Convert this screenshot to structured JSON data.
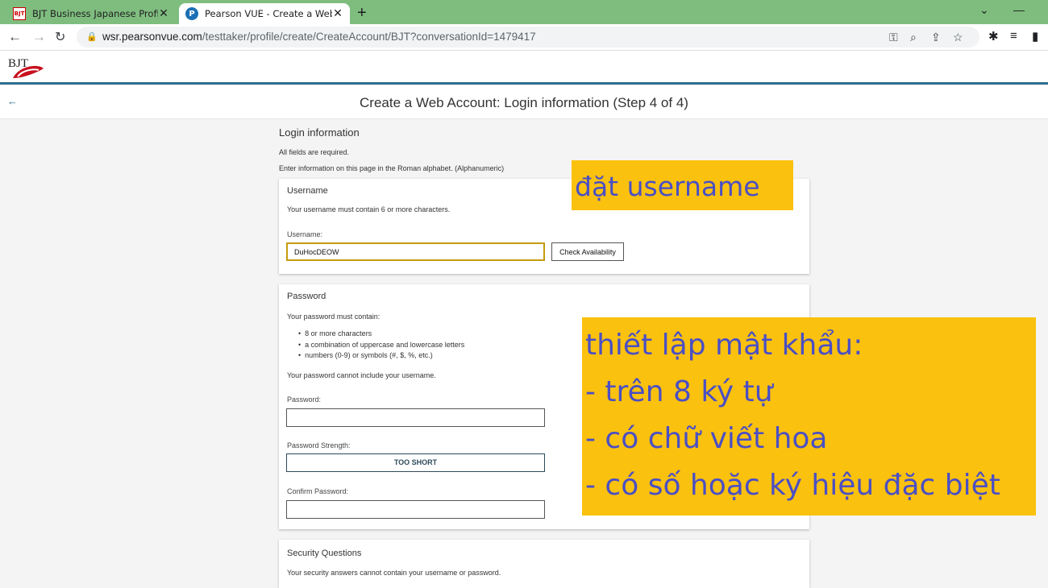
{
  "browser": {
    "tabs": [
      {
        "title": "BJT Business Japanese Proficienc",
        "favicon": "BJT",
        "active": false
      },
      {
        "title": "Pearson VUE - Create a Web Acco",
        "favicon": "P",
        "active": true
      }
    ],
    "url_host": "wsr.pearsonvue.com",
    "url_path": "/testtaker/profile/create/CreateAccount/BJT?conversationId=1479417"
  },
  "site": {
    "logo_text": "BJT",
    "page_title": "Create a Web Account: Login information (Step 4 of 4)"
  },
  "form": {
    "section_title": "Login information",
    "note_required": "All fields are required.",
    "note_roman": "Enter information on this page in the Roman alphabet. (Alphanumeric)",
    "username": {
      "title": "Username",
      "rule": "Your username must contain 6 or more characters.",
      "label": "Username:",
      "value": "DuHocDEOW",
      "check_button": "Check Availability"
    },
    "password": {
      "title": "Password",
      "intro": "Your password must contain:",
      "requirements": [
        "8 or more characters",
        "a combination of uppercase and lowercase letters",
        "numbers (0-9) or symbols (#, $, %, etc.)"
      ],
      "no_username": "Your password cannot include your username.",
      "label": "Password:",
      "value": "",
      "strength_label": "Password Strength:",
      "strength_value": "TOO SHORT",
      "confirm_label": "Confirm Password:",
      "confirm_value": ""
    },
    "security": {
      "title": "Security Questions",
      "rule": "Your security answers cannot contain your username or password."
    }
  },
  "annotations": {
    "username_note": "đặt username",
    "password_note": [
      "thiết lập mật khẩu:",
      "- trên 8 ký tự",
      "- có chữ viết hoa",
      "- có số hoặc ký hiệu đặc biệt"
    ]
  },
  "colors": {
    "tab_strip": "#7fbd7f",
    "annotation_bg": "#fbc10f",
    "annotation_text": "#4a4fc4",
    "header_rule": "#2e6e8e",
    "focus_border": "#c59b0f"
  }
}
